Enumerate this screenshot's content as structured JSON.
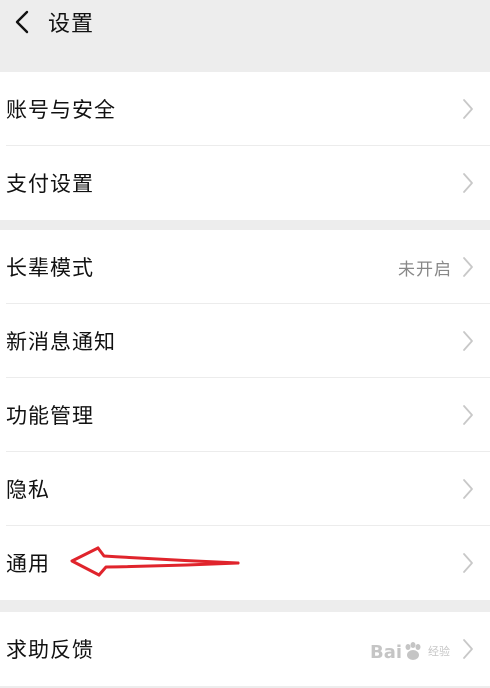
{
  "header": {
    "title": "设置",
    "back_icon": "chevron-left-icon"
  },
  "groups": [
    {
      "items": [
        {
          "label": "账号与安全",
          "value": ""
        },
        {
          "label": "支付设置",
          "value": ""
        }
      ]
    },
    {
      "items": [
        {
          "label": "长辈模式",
          "value": "未开启"
        },
        {
          "label": "新消息通知",
          "value": ""
        },
        {
          "label": "功能管理",
          "value": ""
        },
        {
          "label": "隐私",
          "value": ""
        },
        {
          "label": "通用",
          "value": ""
        }
      ]
    },
    {
      "items": [
        {
          "label": "求助反馈",
          "value": ""
        }
      ]
    }
  ],
  "annotation": {
    "type": "red-arrow",
    "target": "通用",
    "color": "#e0242c"
  },
  "watermark": {
    "brand": "Bai",
    "sub": "经验"
  },
  "colors": {
    "background": "#ededed",
    "card": "#ffffff",
    "text": "#111111",
    "secondary_text": "#888888",
    "chevron": "#c8c8c8"
  }
}
